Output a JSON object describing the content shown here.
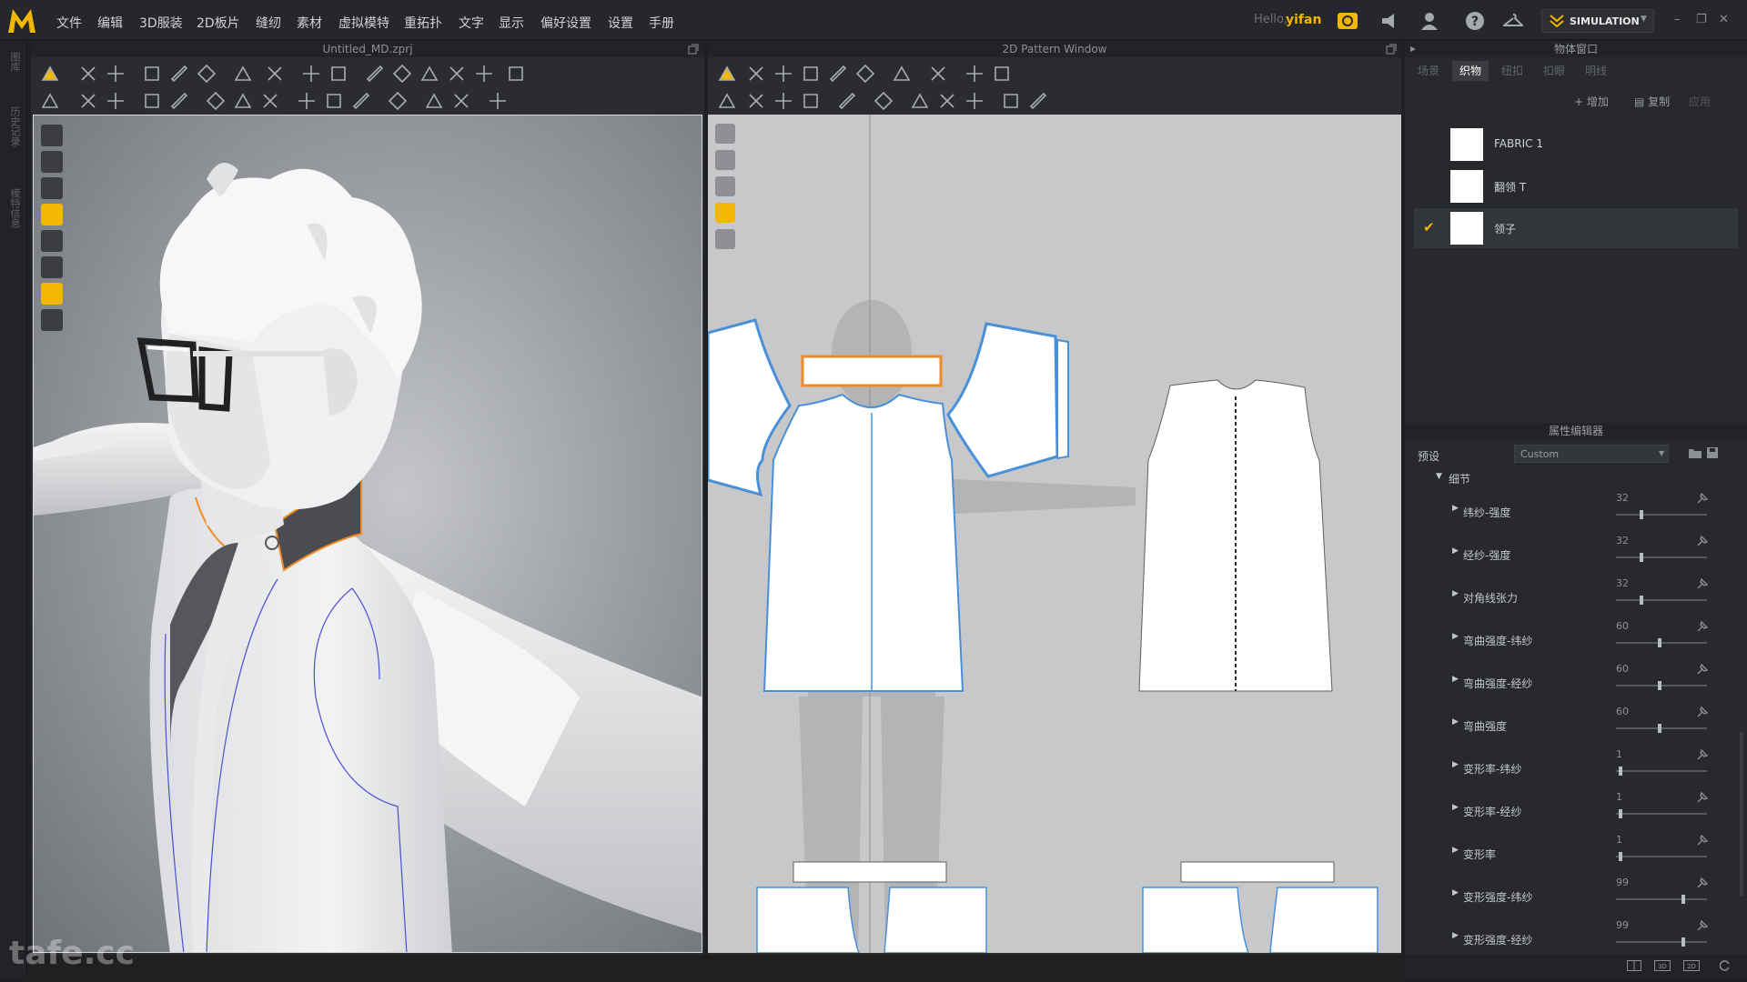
{
  "menu": {
    "items": [
      "文件",
      "编辑",
      "3D服装",
      "2D板片",
      "缝纫",
      "素材",
      "虚拟模特",
      "重拓扑",
      "文字",
      "显示",
      "偏好设置",
      "设置",
      "手册"
    ],
    "hello": "Hello,",
    "username": "yifan",
    "mode": "SIMULATION"
  },
  "left_strip": {
    "labels": [
      "图库",
      "历史记录",
      "模特信息"
    ]
  },
  "window3d": {
    "title": "Untitled_MD.zprj"
  },
  "window2d": {
    "title": "2D Pattern Window"
  },
  "object_browser": {
    "title": "物体窗口",
    "tabs": [
      "场景",
      "织物",
      "纽扣",
      "扣眼",
      "明线"
    ],
    "active_tab": "织物",
    "add_label": "+ 增加",
    "copy_label": "复制",
    "apply_label": "应用",
    "fabrics": [
      {
        "name": "FABRIC 1",
        "selected": false
      },
      {
        "name": "翻领 T",
        "selected": false
      },
      {
        "name": "领子",
        "selected": true
      }
    ]
  },
  "property_editor": {
    "title": "属性编辑器",
    "preset_label": "预设",
    "preset_value": "Custom",
    "section": "细节",
    "properties": [
      {
        "label": "纬纱-强度",
        "value": 32,
        "fraction": 0.27
      },
      {
        "label": "经纱-强度",
        "value": 32,
        "fraction": 0.27
      },
      {
        "label": "对角线张力",
        "value": 32,
        "fraction": 0.27
      },
      {
        "label": "弯曲强度-纬纱",
        "value": 60,
        "fraction": 0.48
      },
      {
        "label": "弯曲强度-经纱",
        "value": 60,
        "fraction": 0.48
      },
      {
        "label": "弯曲强度",
        "value": 60,
        "fraction": 0.48
      },
      {
        "label": "变形率-纬纱",
        "value": 1,
        "fraction": 0.03
      },
      {
        "label": "变形率-经纱",
        "value": 1,
        "fraction": 0.03
      },
      {
        "label": "变形率",
        "value": 1,
        "fraction": 0.03
      },
      {
        "label": "变形强度-纬纱",
        "value": 99,
        "fraction": 0.75
      },
      {
        "label": "变形强度-经纱",
        "value": 99,
        "fraction": 0.75
      }
    ]
  },
  "watermark": "tafe.cc",
  "colors": {
    "accent": "#f2b705",
    "selection": "#f08a24",
    "pattern_outline": "#4a90d9"
  }
}
